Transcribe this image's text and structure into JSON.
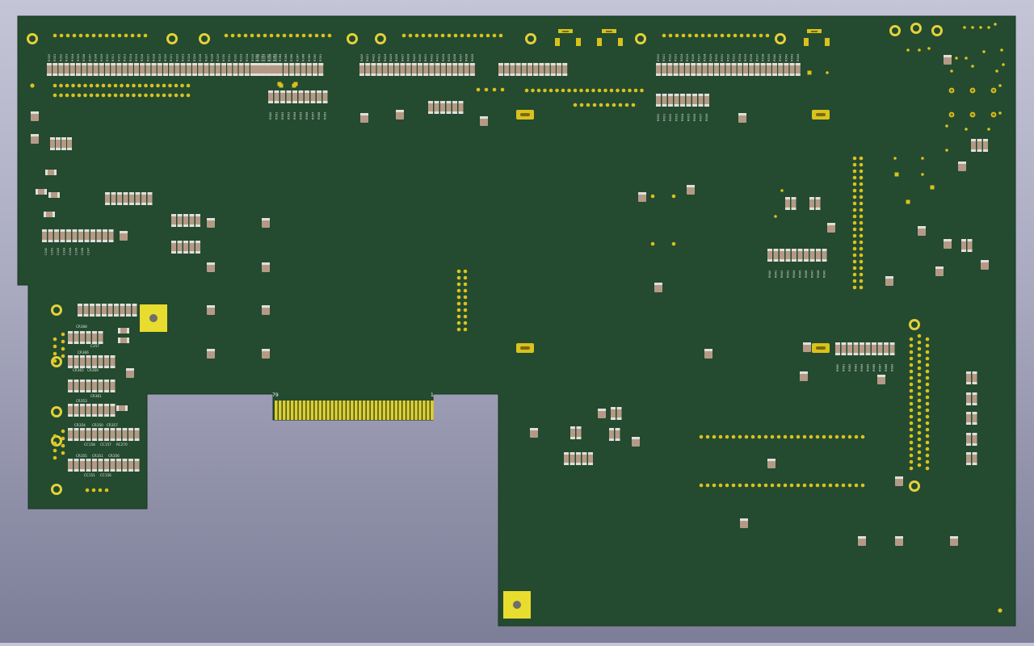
{
  "viewer": {
    "background": [
      "#c4c5d6",
      "#7c7d97"
    ]
  },
  "board": {
    "solder_mask": "#244a30",
    "outline": "#1a3622",
    "pad_color": "#d9c21c",
    "pad_dark": "#7a6a10",
    "component_body": "#b49a86",
    "component_end": "#e0e0da",
    "edge_connector_color": "#e3cd2a",
    "edge_connector": {
      "pin_first": "1",
      "pin_last": "79",
      "finger_count": 40
    },
    "mounting_hole_count": 2,
    "silkscreen": {
      "left_module_labels": [
        "CR368",
        "C357",
        "CR366",
        "CR365",
        "CR369",
        "CR361",
        "CR353",
        "CR354",
        "CR350",
        "CR357",
        "CC158",
        "CC157",
        "RC270",
        "CR355",
        "CR351",
        "CR356",
        "CC151",
        "CC156"
      ],
      "resistor_prefix": "R",
      "capacitor_prefix": "C"
    }
  }
}
